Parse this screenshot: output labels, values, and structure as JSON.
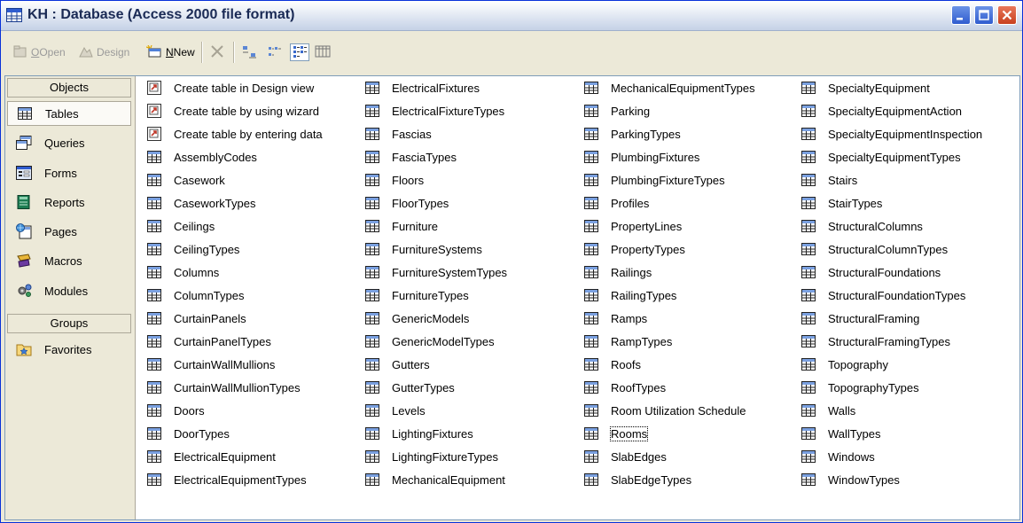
{
  "window": {
    "title": "KH : Database (Access 2000 file format)"
  },
  "toolbar": {
    "open_label": "Open",
    "design_label": "Design",
    "new_label": "New",
    "open_mn": "O",
    "design_mn": "D",
    "new_mn": "N"
  },
  "objects_bar": {
    "header": "Objects",
    "items": [
      {
        "label": "Tables",
        "icon": "table-icon",
        "selected": true
      },
      {
        "label": "Queries",
        "icon": "query-icon"
      },
      {
        "label": "Forms",
        "icon": "form-icon"
      },
      {
        "label": "Reports",
        "icon": "report-icon"
      },
      {
        "label": "Pages",
        "icon": "page-icon"
      },
      {
        "label": "Macros",
        "icon": "macro-icon"
      },
      {
        "label": "Modules",
        "icon": "module-icon"
      }
    ],
    "groups_header": "Groups",
    "groups": [
      {
        "label": "Favorites",
        "icon": "favorites-folder-icon"
      }
    ]
  },
  "shortcuts": [
    "Create table in Design view",
    "Create table by using wizard",
    "Create table by entering data"
  ],
  "tables": [
    "AssemblyCodes",
    "Casework",
    "CaseworkTypes",
    "Ceilings",
    "CeilingTypes",
    "Columns",
    "ColumnTypes",
    "CurtainPanels",
    "CurtainPanelTypes",
    "CurtainWallMullions",
    "CurtainWallMullionTypes",
    "Doors",
    "DoorTypes",
    "ElectricalEquipment",
    "ElectricalEquipmentTypes",
    "ElectricalFixtures",
    "ElectricalFixtureTypes",
    "Fascias",
    "FasciaTypes",
    "Floors",
    "FloorTypes",
    "Furniture",
    "FurnitureSystems",
    "FurnitureSystemTypes",
    "FurnitureTypes",
    "GenericModels",
    "GenericModelTypes",
    "Gutters",
    "GutterTypes",
    "Levels",
    "LightingFixtures",
    "LightingFixtureTypes",
    "MechanicalEquipment",
    "MechanicalEquipmentTypes",
    "Parking",
    "ParkingTypes",
    "PlumbingFixtures",
    "PlumbingFixtureTypes",
    "Profiles",
    "PropertyLines",
    "PropertyTypes",
    "Railings",
    "RailingTypes",
    "Ramps",
    "RampTypes",
    "Roofs",
    "RoofTypes",
    "Room Utilization Schedule",
    "Rooms",
    "SlabEdges",
    "SlabEdgeTypes",
    "SpecialtyEquipment",
    "SpecialtyEquipmentAction",
    "SpecialtyEquipmentInspection",
    "SpecialtyEquipmentTypes",
    "Stairs",
    "StairTypes",
    "StructuralColumns",
    "StructuralColumnTypes",
    "StructuralFoundations",
    "StructuralFoundationTypes",
    "StructuralFraming",
    "StructuralFramingTypes",
    "Topography",
    "TopographyTypes",
    "Walls",
    "WallTypes",
    "Windows",
    "WindowTypes"
  ],
  "focused_item": "Rooms"
}
